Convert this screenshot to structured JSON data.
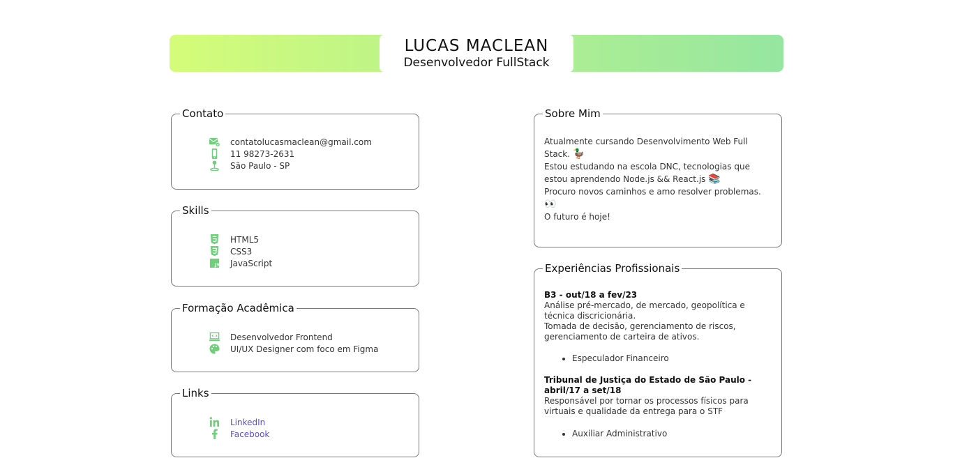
{
  "header": {
    "name": "LUCAS MACLEAN",
    "role": "Desenvolvedor FullStack"
  },
  "contato": {
    "title": "Contato",
    "items": [
      {
        "icon": "email-icon",
        "text": "contatolucasmaclean@gmail.com"
      },
      {
        "icon": "phone-icon",
        "text": "11 98273-2631"
      },
      {
        "icon": "location-icon",
        "text": "São Paulo - SP"
      }
    ]
  },
  "skills": {
    "title": "Skills",
    "items": [
      {
        "icon": "html5-icon",
        "text": "HTML5"
      },
      {
        "icon": "css3-icon",
        "text": "CSS3"
      },
      {
        "icon": "javascript-icon",
        "text": "JavaScript"
      }
    ]
  },
  "formacao": {
    "title": "Formação Acadêmica",
    "items": [
      {
        "icon": "code-laptop-icon",
        "text": "Desenvolvedor Frontend"
      },
      {
        "icon": "palette-icon",
        "text": "UI/UX Designer com foco em Figma"
      }
    ]
  },
  "links": {
    "title": "Links",
    "items": [
      {
        "icon": "linkedin-icon",
        "text": "LinkedIn"
      },
      {
        "icon": "facebook-icon",
        "text": "Facebook"
      }
    ]
  },
  "sobre": {
    "title": "Sobre Mim",
    "line1": "Atualmente cursando Desenvolvimento Web Full Stack.",
    "emoji1": "🦆",
    "line2": "Estou estudando na escola DNC, tecnologias que estou aprendendo Node.js && React.js",
    "emoji2": "📚",
    "line3": "Procuro novos caminhos e amo resolver problemas.",
    "emoji3": "👀",
    "line4": "O futuro é hoje!"
  },
  "experiencias": {
    "title": "Experiências Profissionais",
    "jobs": [
      {
        "title": "B3 - out/18 a fev/23",
        "desc1": "Análise pré-mercado, de mercado, geopolítica e técnica discricionária.",
        "desc2": "Tomada de decisão, gerenciamento de riscos, gerenciamento de carteira de ativos.",
        "role": "Especulador Financeiro"
      },
      {
        "title": "Tribunal de Justiça do Estado de São Paulo - abril/17 a set/18",
        "desc1": "Responsável por tornar os processos físicos para virtuais e qualidade da entrega para o STF",
        "role": "Auxiliar Administrativo"
      }
    ]
  },
  "colors": {
    "accent": "#6fcf7a",
    "gradient_start": "#d4fc79",
    "gradient_end": "#96e6a1",
    "link": "#5a4fd1"
  }
}
